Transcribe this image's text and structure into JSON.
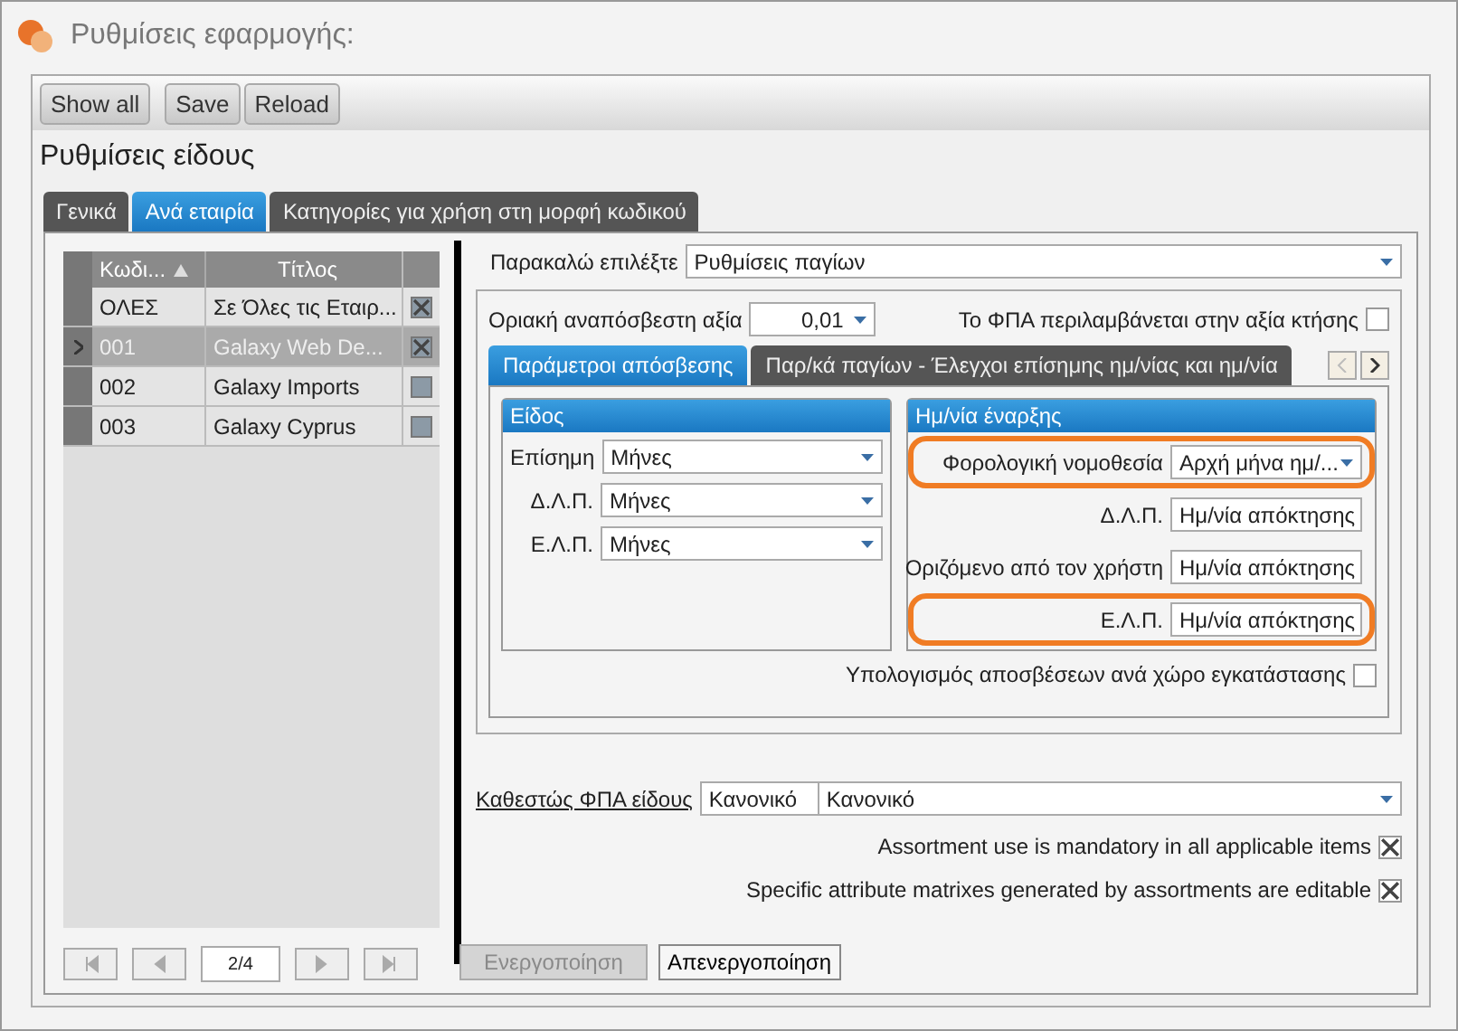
{
  "window": {
    "title": "Ρυθμίσεις εφαρμογής:"
  },
  "toolbar": [
    {
      "label": "Show all"
    },
    {
      "label": "Save"
    },
    {
      "label": "Reload"
    }
  ],
  "heading": "Ρυθμίσεις είδους",
  "tabs": [
    {
      "label": "Γενικά",
      "selected": false
    },
    {
      "label": "Ανά εταιρία",
      "selected": true
    },
    {
      "label": "Κατηγορίες για χρήση στη μορφή κωδικού",
      "selected": false
    }
  ],
  "grid": {
    "columns": [
      "Κωδι...",
      "Τίτλος"
    ],
    "rows": [
      {
        "code": "ΟΛΕΣ",
        "title": "Σε Όλες τις Εταιρ...",
        "checked": true,
        "selected": false
      },
      {
        "code": "001",
        "title": "Galaxy Web De...",
        "checked": true,
        "selected": true
      },
      {
        "code": "002",
        "title": "Galaxy Imports",
        "checked": false,
        "selected": false
      },
      {
        "code": "003",
        "title": "Galaxy Cyprus",
        "checked": false,
        "selected": false
      }
    ]
  },
  "pager": {
    "position": "2/4"
  },
  "actions": [
    {
      "label": "Ενεργοποίηση",
      "disabled": true
    },
    {
      "label": "Απενεργοποίηση",
      "disabled": false
    }
  ],
  "settings": {
    "select_label": "Παρακαλώ επιλέξτε",
    "select_value": "Ρυθμίσεις παγίων",
    "threshold_label": "Οριακή αναπόσβεστη αξία",
    "threshold_value": "0,01",
    "vat_included": {
      "label": "Το ΦΠΑ περιλαμβάνεται στην αξία κτήσης",
      "checked": false
    },
    "subtabs": [
      {
        "label": "Παράμετροι απόσβεσης",
        "selected": true
      },
      {
        "label": "Παρ/κά παγίων - Έλεγχοι επίσημης ημ/νίας και ημ/νία",
        "selected": false
      }
    ],
    "type_group": {
      "title": "Είδος",
      "rows": [
        {
          "label": "Επίσημη",
          "value": "Μήνες"
        },
        {
          "label": "Δ.Λ.Π.",
          "value": "Μήνες"
        },
        {
          "label": "Ε.Λ.Π.",
          "value": "Μήνες"
        }
      ]
    },
    "start_group": {
      "title": "Ημ/νία έναρξης",
      "rows": [
        {
          "label": "Φορολογική νομοθεσία",
          "value": "Αρχή μήνα ημ/...",
          "highlighted": true
        },
        {
          "label": "Δ.Λ.Π.",
          "value": "Ημ/νία απόκτησης",
          "highlighted": false
        },
        {
          "label": "Οριζόμενο από τον χρήστη",
          "value": "Ημ/νία απόκτησης",
          "highlighted": false
        },
        {
          "label": "Ε.Λ.Π.",
          "value": "Ημ/νία απόκτησης",
          "highlighted": true
        }
      ]
    },
    "per_location": {
      "label": "Υπολογισμός αποσβέσεων ανά χώρο εγκατάστασης",
      "checked": false
    }
  },
  "vat_status": {
    "label": "Καθεστώς ΦΠΑ είδους",
    "code": "Κανονικό",
    "value": "Κανονικό"
  },
  "options": [
    {
      "label": "Assortment use is mandatory in all applicable items",
      "checked": true
    },
    {
      "label": "Specific attribute matrixes generated by assortments are editable",
      "checked": true
    }
  ]
}
